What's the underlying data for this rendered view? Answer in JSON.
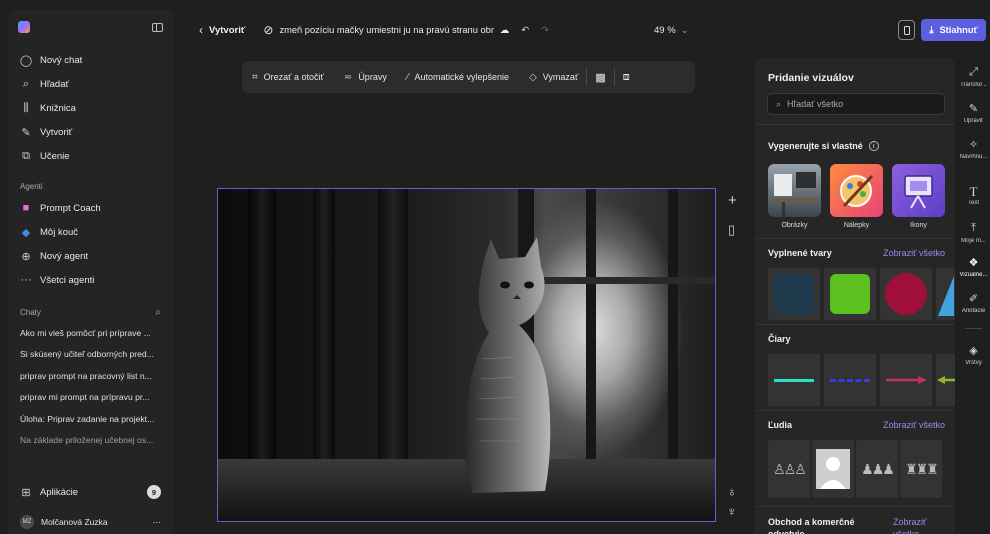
{
  "sidebar": {
    "nav": [
      {
        "label": "Nový chat",
        "icon": "chat-bubble-icon"
      },
      {
        "label": "Hľadať",
        "icon": "search-icon"
      },
      {
        "label": "Knižnica",
        "icon": "library-icon"
      },
      {
        "label": "Vytvoriť",
        "icon": "create-icon"
      },
      {
        "label": "Učenie",
        "icon": "learning-icon"
      }
    ],
    "agents_label": "Agenti",
    "agents": [
      {
        "label": "Prompt Coach"
      },
      {
        "label": "Môj kouč"
      },
      {
        "label": "Nový agent"
      },
      {
        "label": "Všetci agenti"
      }
    ],
    "chats_label": "Chaty",
    "chats": [
      "Ako mi vieš pomôcť pri príprave ...",
      "Si skúsený učiteľ odborných pred...",
      "priprav prompt na pracovný list n...",
      "priprav mi prompt na prípravu pr...",
      "Úloha: Priprav zadanie na projekt...",
      "Na základe priloženej učebnej os..."
    ],
    "apps_label": "Aplikácie",
    "apps_badge": "9",
    "user_initials": "MZ",
    "user_name": "Molčanová Zuzka",
    "user_menu": "···"
  },
  "topbar": {
    "back_label": "Vytvoriť",
    "doc_title": "zmeň pozíciu mačky umiestni ju na pravú stranu obr",
    "zoom": "49 %",
    "download_label": "Stiahnuť"
  },
  "toolbar": {
    "crop": "Orezať a otočiť",
    "adjust": "Úpravy",
    "auto": "Automatické vylepšenie",
    "erase": "Vymazať"
  },
  "panel": {
    "title": "Pridanie vizuálov",
    "search_placeholder": "Hľadať všetko",
    "generate_title": "Vygenerujte si vlastné",
    "gen_items": [
      "Obrázky",
      "Nálepky",
      "Ikony"
    ],
    "shapes_title": "Vyplnené tvary",
    "shapes_see_all": "Zobraziť všetko",
    "shape_colors": [
      "#1e3a4c",
      "#5cc01f",
      "#9e0f3a",
      "#3fa4e0"
    ],
    "lines_title": "Čiary",
    "line_colors": [
      "#2ae0c8",
      "#3a3ae8",
      "#c0335c",
      "#8bb82c"
    ],
    "people_title": "Ľudia",
    "people_see_all": "Zobraziť všetko",
    "business_title": "Obchod a komerčné odvetvie",
    "business_see_all": "Zobraziť všetko"
  },
  "rstrip": [
    {
      "label": "Transfor...",
      "icon": "transform-icon"
    },
    {
      "label": "Upraviť",
      "icon": "edit-icon"
    },
    {
      "label": "Navrhnú...",
      "icon": "design-icon"
    },
    {
      "label": "Text",
      "icon": "text-icon"
    },
    {
      "label": "Moje m...",
      "icon": "upload-icon"
    },
    {
      "label": "Vizuálne...",
      "icon": "visuals-icon"
    },
    {
      "label": "Anotácie",
      "icon": "annotation-icon"
    },
    {
      "label": "Vrstvy",
      "icon": "layers-icon"
    }
  ]
}
